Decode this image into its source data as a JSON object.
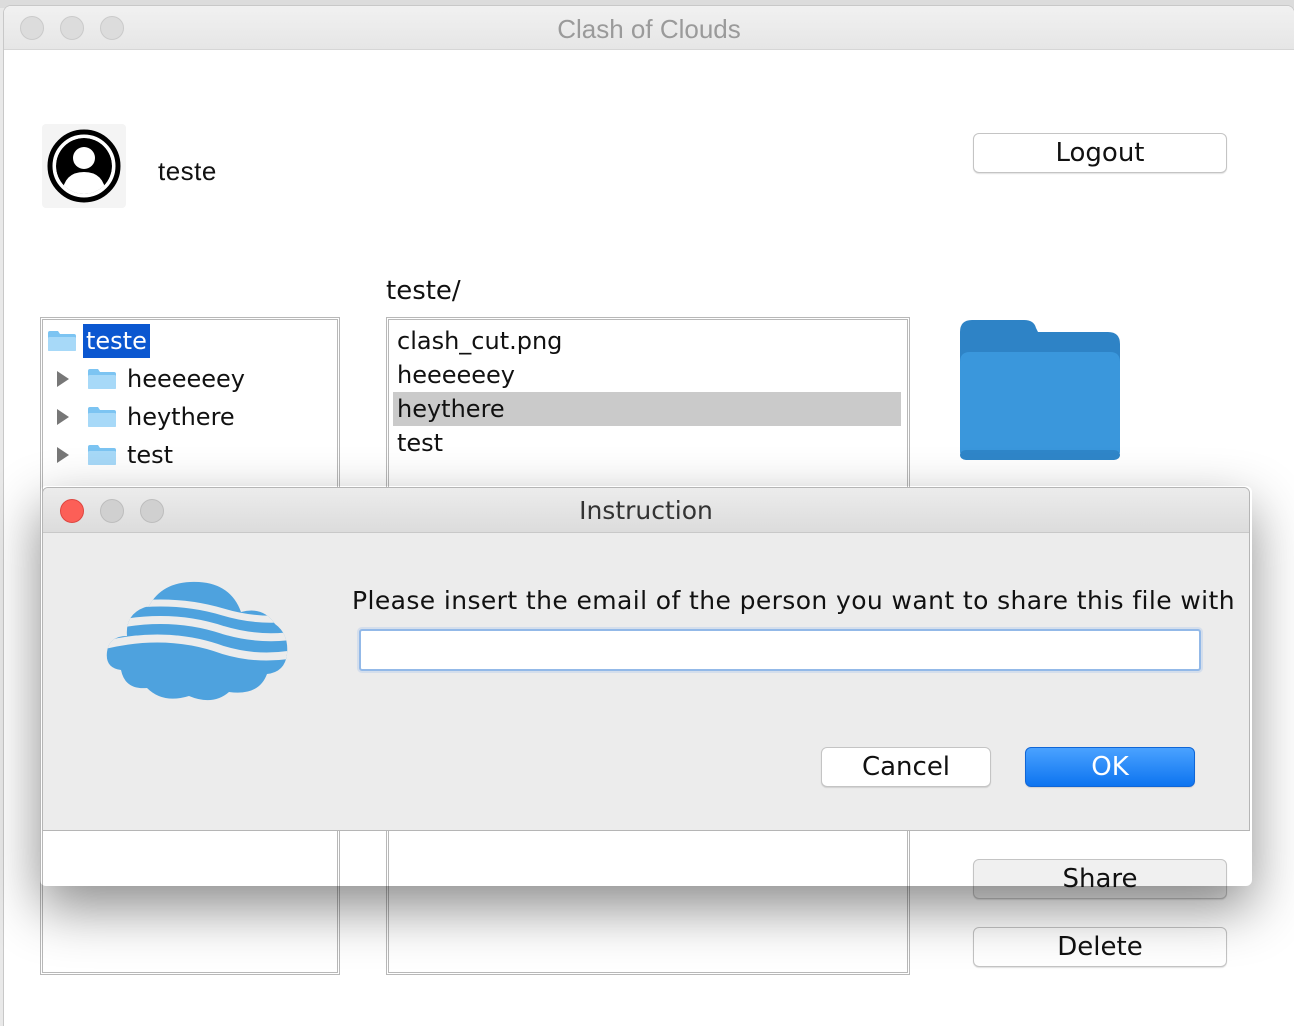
{
  "window": {
    "title": "Clash of Clouds"
  },
  "user": {
    "name": "teste"
  },
  "buttons": {
    "logout": "Logout",
    "share": "Share",
    "delete": "Delete"
  },
  "path": {
    "label": "teste/"
  },
  "tree": {
    "root": "teste",
    "children": [
      "heeeeeey",
      "heythere",
      "test"
    ]
  },
  "files": {
    "items": [
      "clash_cut.png",
      "heeeeeey",
      "heythere",
      "test"
    ],
    "selected": "heythere"
  },
  "dialog": {
    "title": "Instruction",
    "prompt": "Please insert the email of the person you want to share this file with",
    "email_value": "",
    "cancel": "Cancel",
    "ok": "OK"
  },
  "icons": {
    "avatar": "user-avatar-icon",
    "folder_preview": "folder-icon",
    "dialog_logo": "cloud-logo-icon",
    "tree_folder": "folder-icon",
    "tree_expand": "triangle-right-icon"
  },
  "colors": {
    "selection_blue": "#0b57d0",
    "folder_blue": "#3a97dc",
    "ok_button": "#1a7df5",
    "close_red": "#fc5f57"
  }
}
